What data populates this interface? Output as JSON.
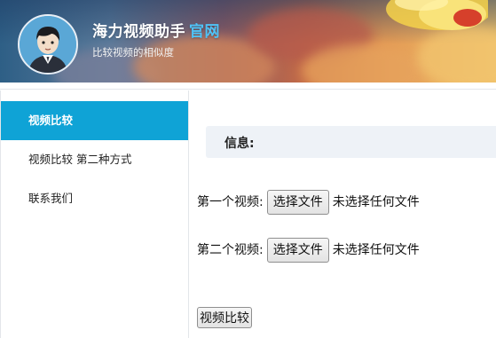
{
  "header": {
    "brand_name": "海力视频助手",
    "brand_accent": "官网",
    "tagline": "比较视频的相似度",
    "accent_color": "#4fc3f7"
  },
  "sidebar": {
    "items": [
      {
        "label": "视频比较",
        "active": true
      },
      {
        "label": "视频比较 第二种方式",
        "active": false
      },
      {
        "label": "联系我们",
        "active": false
      }
    ],
    "active_color": "#0fa3d6"
  },
  "main": {
    "info_label": "信息:",
    "file_inputs": [
      {
        "label": "第一个视频:",
        "button_label": "选择文件",
        "status": "未选择任何文件"
      },
      {
        "label": "第二个视频:",
        "button_label": "选择文件",
        "status": "未选择任何文件"
      }
    ],
    "compare_button_label": "视频比较"
  }
}
